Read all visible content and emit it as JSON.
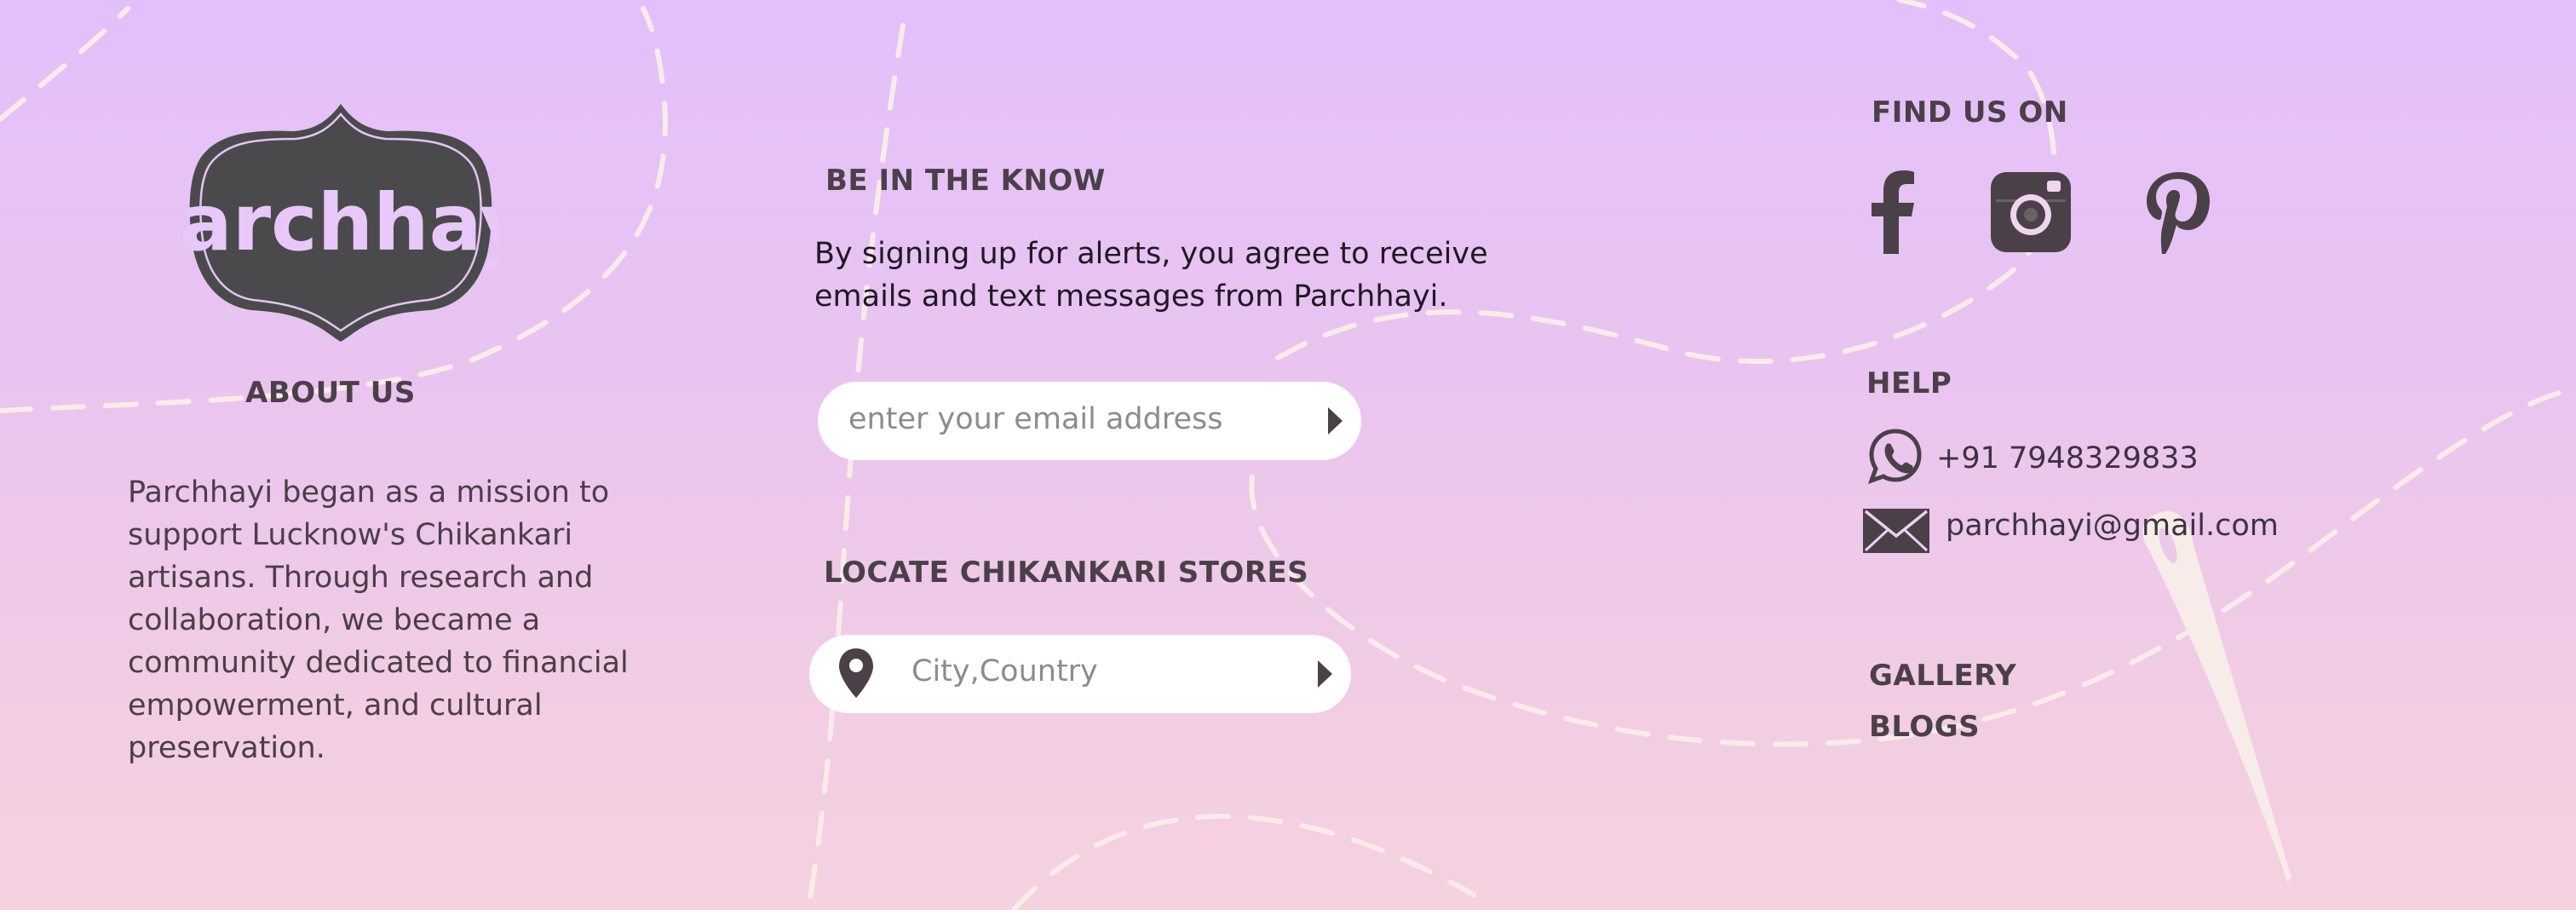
{
  "brand": {
    "logo_text": "Parchhayi"
  },
  "about": {
    "heading": "ABOUT US",
    "lines": [
      "Parchhayi began as a mission to",
      "support Lucknow's Chikankari",
      "artisans. Through research and",
      "collaboration, we became a",
      "community dedicated to financial",
      "empowerment, and cultural",
      "preservation."
    ]
  },
  "newsletter": {
    "heading": "BE IN THE KNOW",
    "line1": "By signing up for alerts, you agree to receive",
    "line2": "emails and text messages from Parchhayi.",
    "email_placeholder": "enter your email address"
  },
  "locate": {
    "heading": "LOCATE CHIKANKARI STORES",
    "placeholder": "City,Country"
  },
  "social": {
    "heading": "FIND US ON",
    "icons": [
      "facebook-icon",
      "instagram-icon",
      "pinterest-icon"
    ]
  },
  "help": {
    "heading": "HELP",
    "phone": "+91 7948329833",
    "email": "parchhayi@gmail.com"
  },
  "links": {
    "gallery": "GALLERY",
    "blogs": "BLOGS"
  },
  "colors": {
    "dark": "#4a4148",
    "bg_top": "#e3c0fb",
    "bg_bottom": "#f5d2e0",
    "thread": "#f8ece8"
  }
}
